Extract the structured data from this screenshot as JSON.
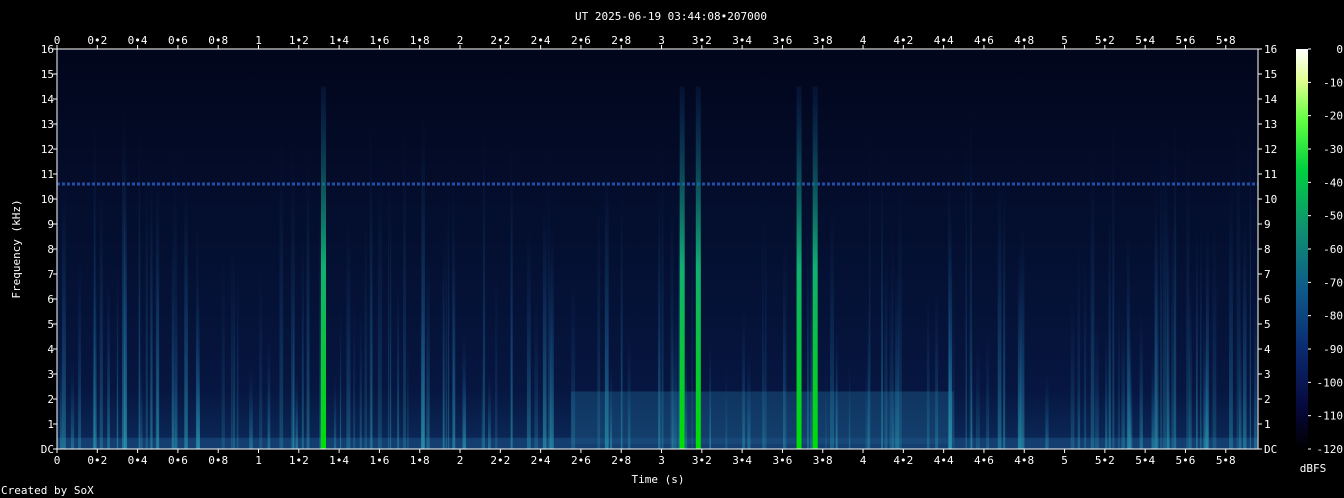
{
  "chart_data": {
    "type": "heatmap",
    "title": "UT 2025-06-19 03:44:08•207000",
    "xlabel": "Time (s)",
    "ylabel": "Frequency (kHz)",
    "xlim": [
      0,
      5.96
    ],
    "ylim": [
      0,
      16
    ],
    "x_ticks": [
      "0",
      "0•2",
      "0•4",
      "0•6",
      "0•8",
      "1",
      "1•2",
      "1•4",
      "1•6",
      "1•8",
      "2",
      "2•2",
      "2•4",
      "2•6",
      "2•8",
      "3",
      "3•2",
      "3•4",
      "3•6",
      "3•8",
      "4",
      "4•2",
      "4•4",
      "4•6",
      "4•8",
      "5",
      "5•2",
      "5•4",
      "5•6",
      "5•8"
    ],
    "x_tick_values": [
      0,
      0.2,
      0.4,
      0.6,
      0.8,
      1,
      1.2,
      1.4,
      1.6,
      1.8,
      2,
      2.2,
      2.4,
      2.6,
      2.8,
      3,
      3.2,
      3.4,
      3.6,
      3.8,
      4,
      4.2,
      4.4,
      4.6,
      4.8,
      5,
      5.2,
      5.4,
      5.6,
      5.8
    ],
    "y_ticks": [
      "DC",
      "1",
      "2",
      "3",
      "4",
      "5",
      "6",
      "7",
      "8",
      "9",
      "10",
      "11",
      "12",
      "13",
      "14",
      "15",
      "16"
    ],
    "colorbar": {
      "label": "dBFS",
      "ticks": [
        "0",
        "-10",
        "-20",
        "-30",
        "-40",
        "-50",
        "-60",
        "-70",
        "-80",
        "-90",
        "-100",
        "-110",
        "-120"
      ],
      "range": [
        -120,
        0
      ]
    },
    "features": {
      "tone_khz": 10.6,
      "strong_events_s": [
        1.32,
        3.1,
        3.18,
        3.68,
        3.76
      ],
      "band_region_s": [
        2.55,
        4.45
      ],
      "band_region_khz": [
        0.2,
        2.3
      ]
    },
    "grid": false,
    "legend": "colorbar-right"
  },
  "footer": {
    "credit": "Created by SoX"
  },
  "colors": {
    "background": "#000000",
    "tone": "#1f4fa8",
    "bright": "#00e000"
  }
}
